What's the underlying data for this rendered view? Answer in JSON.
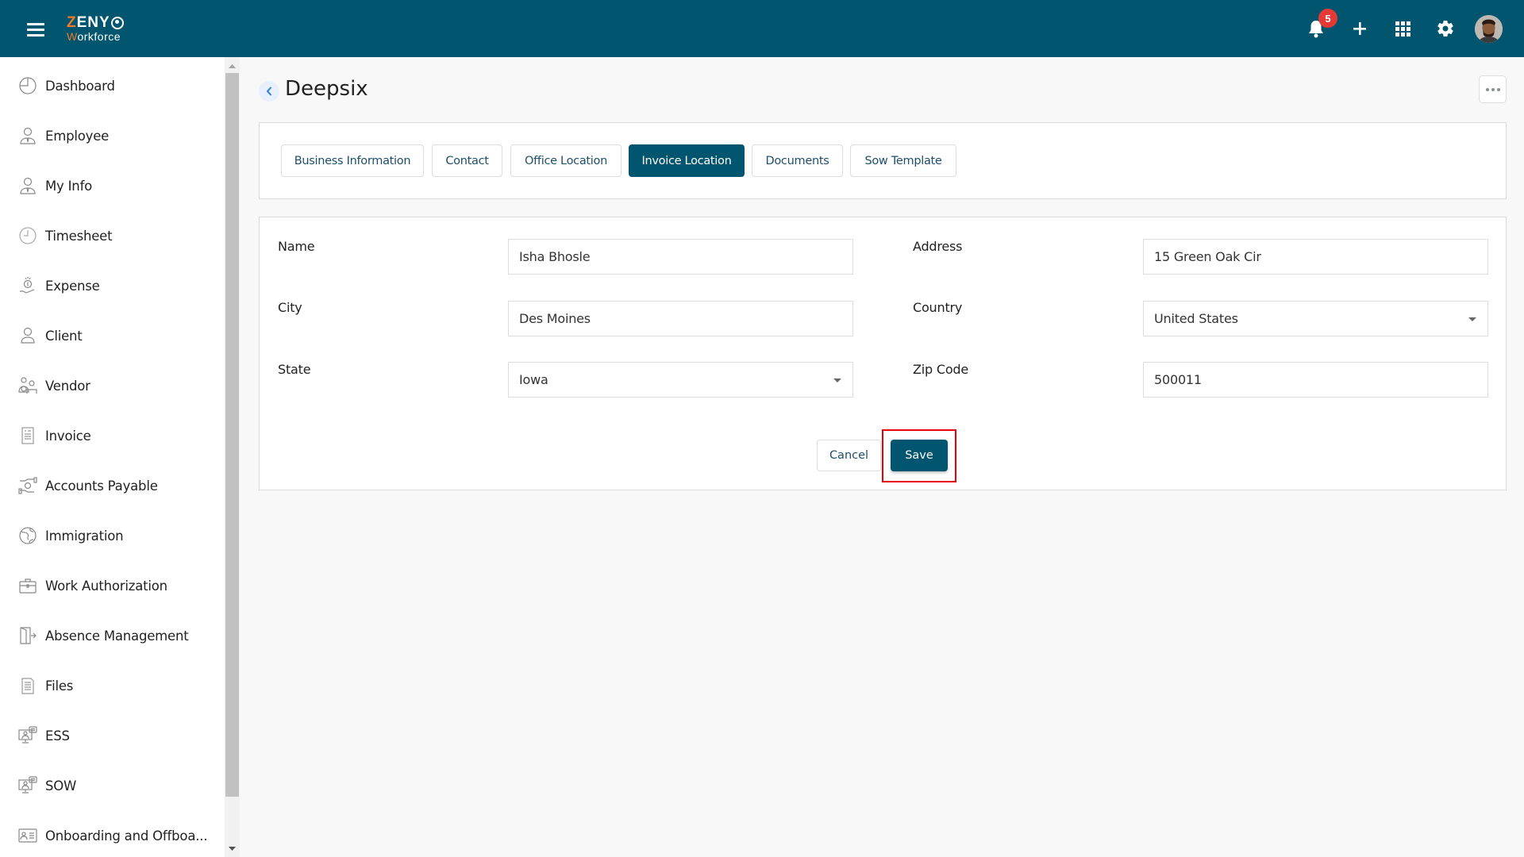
{
  "header": {
    "logo_top": "ZENY",
    "logo_top_accent": "Z",
    "logo_bottom": "Workforce",
    "notification_count": "5",
    "icons": [
      "menu-icon",
      "bell-icon",
      "plus-icon",
      "apps-grid-icon",
      "gear-icon",
      "avatar"
    ]
  },
  "sidebar": {
    "items": [
      {
        "label": "Dashboard",
        "icon": "dashboard-pie-icon"
      },
      {
        "label": "Employee",
        "icon": "employee-icon"
      },
      {
        "label": "My Info",
        "icon": "my-info-icon"
      },
      {
        "label": "Timesheet",
        "icon": "clock-icon"
      },
      {
        "label": "Expense",
        "icon": "expense-hand-coin-icon"
      },
      {
        "label": "Client",
        "icon": "client-user-icon"
      },
      {
        "label": "Vendor",
        "icon": "vendor-icon"
      },
      {
        "label": "Invoice",
        "icon": "invoice-icon"
      },
      {
        "label": "Accounts Payable",
        "icon": "accounts-payable-icon"
      },
      {
        "label": "Immigration",
        "icon": "globe-icon"
      },
      {
        "label": "Work Authorization",
        "icon": "briefcase-icon"
      },
      {
        "label": "Absence Management",
        "icon": "exit-door-icon"
      },
      {
        "label": "Files",
        "icon": "file-icon"
      },
      {
        "label": "ESS",
        "icon": "ess-monitor-icon"
      },
      {
        "label": "SOW",
        "icon": "sow-monitor-icon"
      },
      {
        "label": "Onboarding and Offboa...",
        "icon": "id-card-icon"
      }
    ]
  },
  "page": {
    "title": "Deepsix",
    "tabs": [
      {
        "label": "Business Information",
        "active": false
      },
      {
        "label": "Contact",
        "active": false
      },
      {
        "label": "Office Location",
        "active": false
      },
      {
        "label": "Invoice Location",
        "active": true
      },
      {
        "label": "Documents",
        "active": false
      },
      {
        "label": "Sow Template",
        "active": false
      }
    ]
  },
  "form": {
    "name": {
      "label": "Name",
      "value": "Isha Bhosle"
    },
    "city": {
      "label": "City",
      "value": "Des Moines"
    },
    "state": {
      "label": "State",
      "value": "Iowa"
    },
    "address": {
      "label": "Address",
      "value": "15 Green Oak Cir"
    },
    "country": {
      "label": "Country",
      "value": "United States"
    },
    "zip": {
      "label": "Zip Code",
      "value": "500011"
    },
    "cancel_label": "Cancel",
    "save_label": "Save"
  },
  "colors": {
    "brand": "#02556f",
    "accent": "#f07a26",
    "badge": "#e53935",
    "highlight": "#e8000b"
  }
}
